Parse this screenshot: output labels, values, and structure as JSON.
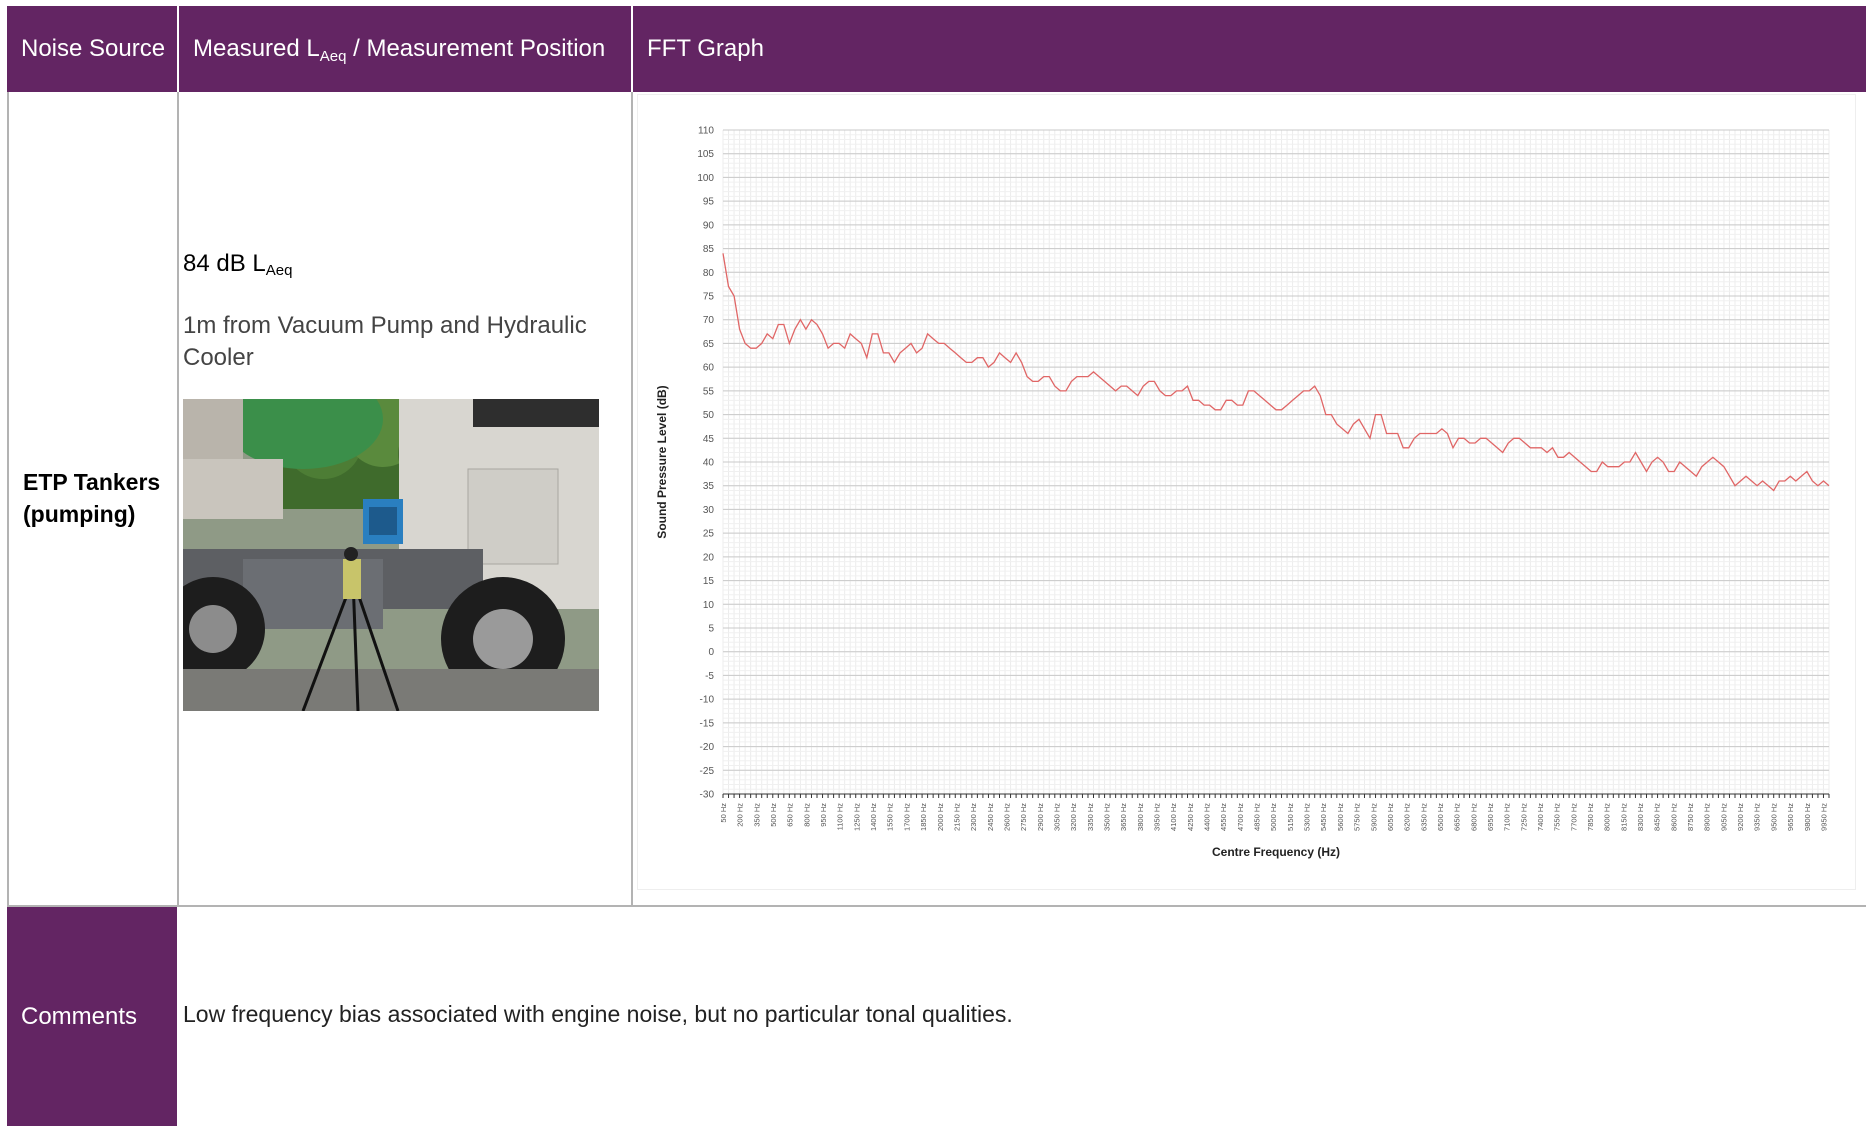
{
  "header": {
    "col1": "Noise Source",
    "col2_main": "Measured L",
    "col2_sub": "Aeq",
    "col2_rest": " / Measurement Position",
    "col3": "FFT Graph"
  },
  "row": {
    "source_line1": "ETP Tankers",
    "source_line2": "(pumping)",
    "measured_value": "84 dB L",
    "measured_sub": "Aeq",
    "position": "1m from Vacuum Pump and Hydraulic Cooler"
  },
  "comments": {
    "label": "Comments",
    "text": "Low frequency bias associated with engine noise, but no particular tonal qualities."
  },
  "colors": {
    "header_bg": "#632563",
    "line": "#e06666"
  },
  "chart_data": {
    "type": "line",
    "xlabel": "Centre Frequency (Hz)",
    "ylabel": "Sound Pressure Level (dB)",
    "ylim": [
      -30,
      110
    ],
    "ytick_step": 5,
    "grid": true,
    "x_ticks": [
      "50 Hz",
      "200 Hz",
      "350 Hz",
      "500 Hz",
      "650 Hz",
      "800 Hz",
      "950 Hz",
      "1100 Hz",
      "1250 Hz",
      "1400 Hz",
      "1550 Hz",
      "1700 Hz",
      "1850 Hz",
      "2000 Hz",
      "2150 Hz",
      "2300 Hz",
      "2450 Hz",
      "2600 Hz",
      "2750 Hz",
      "2900 Hz",
      "3050 Hz",
      "3200 Hz",
      "3350 Hz",
      "3500 Hz",
      "3650 Hz",
      "3800 Hz",
      "3950 Hz",
      "4100 Hz",
      "4250 Hz",
      "4400 Hz",
      "4550 Hz",
      "4700 Hz",
      "4850 Hz",
      "5000 Hz",
      "5150 Hz",
      "5300 Hz",
      "5450 Hz",
      "5600 Hz",
      "5750 Hz",
      "5900 Hz",
      "6050 Hz",
      "6200 Hz",
      "6350 Hz",
      "6500 Hz",
      "6650 Hz",
      "6800 Hz",
      "6950 Hz",
      "7100 Hz",
      "7250 Hz",
      "7400 Hz",
      "7550 Hz",
      "7700 Hz",
      "7850 Hz",
      "8000 Hz",
      "8150 Hz",
      "8300 Hz",
      "8450 Hz",
      "8600 Hz",
      "8750 Hz",
      "8900 Hz",
      "9050 Hz",
      "9200 Hz",
      "9350 Hz",
      "9500 Hz",
      "9650 Hz",
      "9800 Hz",
      "9950 Hz"
    ],
    "series": [
      {
        "x_range_hz": [
          50,
          10000
        ],
        "values": [
          84,
          77,
          75,
          68,
          65,
          64,
          64,
          65,
          67,
          66,
          69,
          69,
          65,
          68,
          70,
          68,
          70,
          69,
          67,
          64,
          65,
          65,
          64,
          67,
          66,
          65,
          62,
          67,
          67,
          63,
          63,
          61,
          63,
          64,
          65,
          63,
          64,
          67,
          66,
          65,
          65,
          64,
          63,
          62,
          61,
          61,
          62,
          62,
          60,
          61,
          63,
          62,
          61,
          63,
          61,
          58,
          57,
          57,
          58,
          58,
          56,
          55,
          55,
          57,
          58,
          58,
          58,
          59,
          58,
          57,
          56,
          55,
          56,
          56,
          55,
          54,
          56,
          57,
          57,
          55,
          54,
          54,
          55,
          55,
          56,
          53,
          53,
          52,
          52,
          51,
          51,
          53,
          53,
          52,
          52,
          55,
          55,
          54,
          53,
          52,
          51,
          51,
          52,
          53,
          54,
          55,
          55,
          56,
          54,
          50,
          50,
          48,
          47,
          46,
          48,
          49,
          47,
          45,
          50,
          50,
          46,
          46,
          46,
          43,
          43,
          45,
          46,
          46,
          46,
          46,
          47,
          46,
          43,
          45,
          45,
          44,
          44,
          45,
          45,
          44,
          43,
          42,
          44,
          45,
          45,
          44,
          43,
          43,
          43,
          42,
          43,
          41,
          41,
          42,
          41,
          40,
          39,
          38,
          38,
          40,
          39,
          39,
          39,
          40,
          40,
          42,
          40,
          38,
          40,
          41,
          40,
          38,
          38,
          40,
          39,
          38,
          37,
          39,
          40,
          41,
          40,
          39,
          37,
          35,
          36,
          37,
          36,
          35,
          36,
          35,
          34,
          36,
          36,
          37,
          36,
          37,
          38,
          36,
          35,
          36,
          35
        ]
      }
    ]
  }
}
